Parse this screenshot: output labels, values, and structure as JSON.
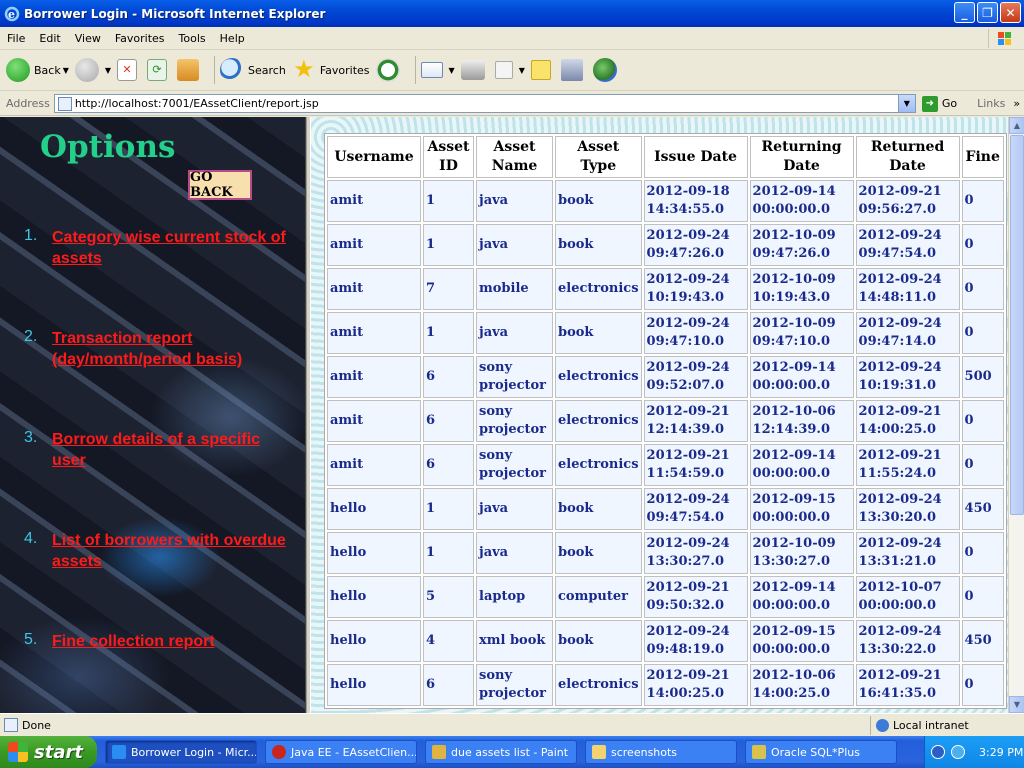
{
  "window": {
    "title": "Borrower Login - Microsoft Internet Explorer",
    "buttons": [
      "minimize",
      "maximize",
      "close"
    ]
  },
  "menu": [
    "File",
    "Edit",
    "View",
    "Favorites",
    "Tools",
    "Help"
  ],
  "toolbar": {
    "back_label": "Back",
    "search_label": "Search",
    "favorites_label": "Favorites"
  },
  "address": {
    "label": "Address",
    "url": "http://localhost:7001/EAssetClient/report.jsp",
    "go_label": "Go",
    "links_label": "Links"
  },
  "left": {
    "heading": "Options",
    "go_back": "GO BACK",
    "items": [
      {
        "num": "1.",
        "label": "Category wise current stock of assets"
      },
      {
        "num": "2.",
        "label": "Transaction report (day/month/period basis)"
      },
      {
        "num": "3.",
        "label": "Borrow details of a specific user"
      },
      {
        "num": "4.",
        "label": "List of borrowers with overdue assets"
      },
      {
        "num": "5.",
        "label": "Fine collection report"
      }
    ]
  },
  "table": {
    "headers": [
      "Username",
      "Asset ID",
      "Asset Name",
      "Asset Type",
      "Issue Date",
      "Returning Date",
      "Returned Date",
      "Fine"
    ],
    "rows": [
      [
        "amit",
        "1",
        "java",
        "book",
        "2012-09-18 14:34:55.0",
        "2012-09-14 00:00:00.0",
        "2012-09-21 09:56:27.0",
        "0"
      ],
      [
        "amit",
        "1",
        "java",
        "book",
        "2012-09-24 09:47:26.0",
        "2012-10-09 09:47:26.0",
        "2012-09-24 09:47:54.0",
        "0"
      ],
      [
        "amit",
        "7",
        "mobile",
        "electronics",
        "2012-09-24 10:19:43.0",
        "2012-10-09 10:19:43.0",
        "2012-09-24 14:48:11.0",
        "0"
      ],
      [
        "amit",
        "1",
        "java",
        "book",
        "2012-09-24 09:47:10.0",
        "2012-10-09 09:47:10.0",
        "2012-09-24 09:47:14.0",
        "0"
      ],
      [
        "amit",
        "6",
        "sony projector",
        "electronics",
        "2012-09-24 09:52:07.0",
        "2012-09-14 00:00:00.0",
        "2012-09-24 10:19:31.0",
        "500"
      ],
      [
        "amit",
        "6",
        "sony projector",
        "electronics",
        "2012-09-21 12:14:39.0",
        "2012-10-06 12:14:39.0",
        "2012-09-21 14:00:25.0",
        "0"
      ],
      [
        "amit",
        "6",
        "sony projector",
        "electronics",
        "2012-09-21 11:54:59.0",
        "2012-09-14 00:00:00.0",
        "2012-09-21 11:55:24.0",
        "0"
      ],
      [
        "hello",
        "1",
        "java",
        "book",
        "2012-09-24 09:47:54.0",
        "2012-09-15 00:00:00.0",
        "2012-09-24 13:30:20.0",
        "450"
      ],
      [
        "hello",
        "1",
        "java",
        "book",
        "2012-09-24 13:30:27.0",
        "2012-10-09 13:30:27.0",
        "2012-09-24 13:31:21.0",
        "0"
      ],
      [
        "hello",
        "5",
        "laptop",
        "computer",
        "2012-09-21 09:50:32.0",
        "2012-09-14 00:00:00.0",
        "2012-10-07 00:00:00.0",
        "0"
      ],
      [
        "hello",
        "4",
        "xml book",
        "book",
        "2012-09-24 09:48:19.0",
        "2012-09-15 00:00:00.0",
        "2012-09-24 13:30:22.0",
        "450"
      ],
      [
        "hello",
        "6",
        "sony projector",
        "electronics",
        "2012-09-21 14:00:25.0",
        "2012-10-06 14:00:25.0",
        "2012-09-21 16:41:35.0",
        "0"
      ]
    ]
  },
  "status": {
    "text": "Done",
    "zone": "Local intranet"
  },
  "taskbar": {
    "start": "start",
    "tasks": [
      {
        "label": "Borrower Login - Micr...",
        "active": true
      },
      {
        "label": "Java EE - EAssetClien...",
        "active": false
      },
      {
        "label": "due assets list - Paint",
        "active": false
      },
      {
        "label": "screenshots",
        "active": false
      },
      {
        "label": "Oracle SQL*Plus",
        "active": false
      }
    ],
    "clock": "3:29 PM"
  }
}
